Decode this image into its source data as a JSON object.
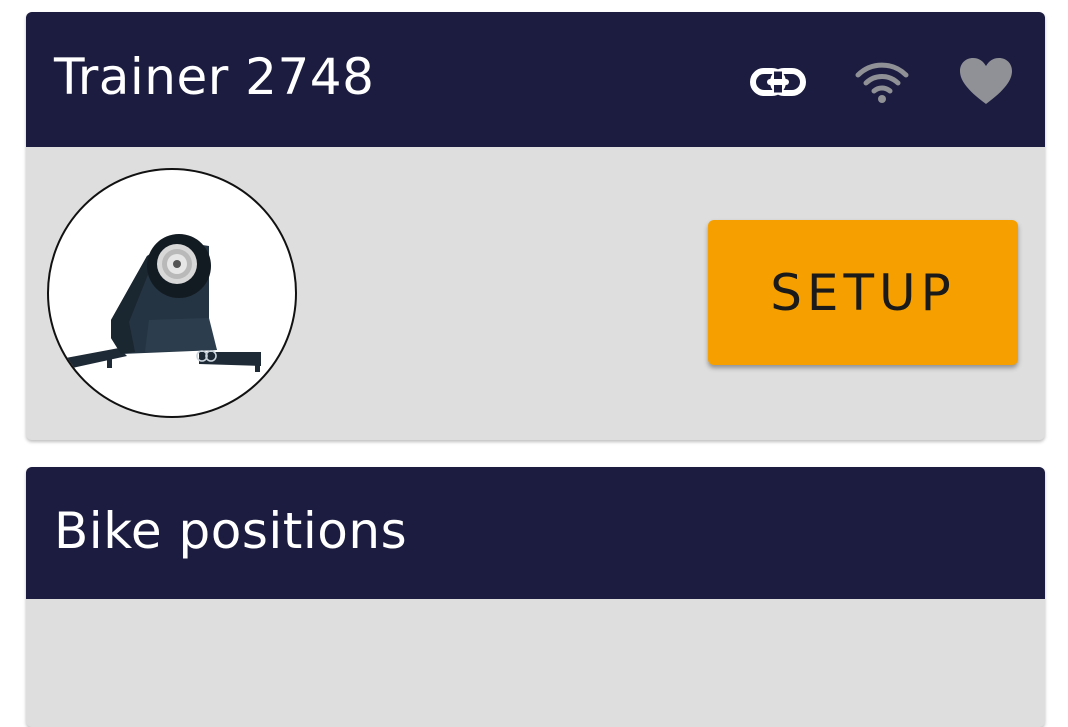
{
  "trainer_card": {
    "title": "Trainer 2748",
    "icons": [
      "link-icon",
      "wifi-icon",
      "heart-icon"
    ],
    "setup_label": "SETUP"
  },
  "positions_card": {
    "title": "Bike positions"
  },
  "colors": {
    "header_bg": "#1c1c40",
    "card_bg": "#dedede",
    "accent": "#f5a000",
    "icon_muted": "#8f9196"
  }
}
